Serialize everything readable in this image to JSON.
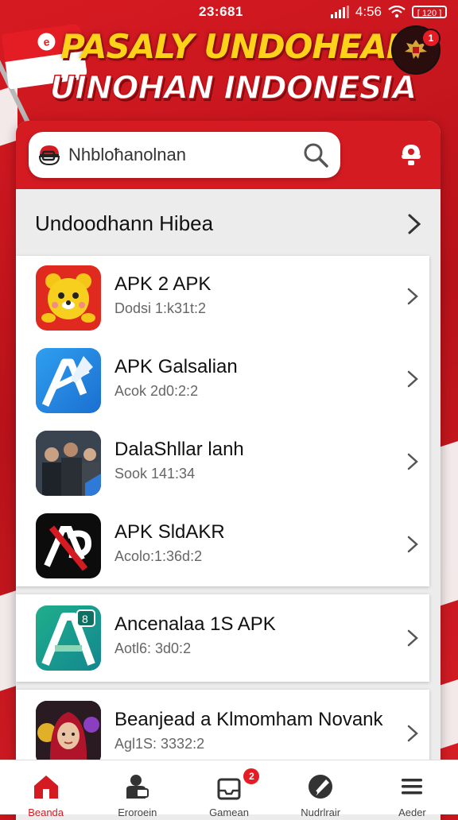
{
  "status_bar": {
    "time": "23:681",
    "carrier": "4:56",
    "battery": "[ 120 ]"
  },
  "header": {
    "title_line1": "PASALY UNDOHEAN",
    "title_line2": "UINOHAN INDONESIA",
    "badge_count": "1"
  },
  "search": {
    "placeholder": "Nhbloħanolnan"
  },
  "section": {
    "title": "Undoodhann Hibea"
  },
  "apps": [
    {
      "name": "APK 2 APK",
      "meta": "Dodsi 1:k31t:2",
      "icon": "bear-icon"
    },
    {
      "name": "APK Galsalian",
      "meta": "Acok 2d0:2:2",
      "icon": "pen-a-icon"
    },
    {
      "name": "DalaShllar lanh",
      "meta": "Sook 141:34",
      "icon": "photo-people-icon"
    },
    {
      "name": "APK SldAKR",
      "meta": "Acolo:1:36d:2",
      "icon": "ap-logo-icon"
    }
  ],
  "featured": [
    {
      "name": "Ancenalaa 1S APK",
      "meta": "Aotl6: 3d0:2",
      "icon": "green-a-icon"
    },
    {
      "name": "Beanjead a Klmomham Novank",
      "meta": "Agl1S: 3332:2",
      "icon": "hijab-avatar-icon"
    }
  ],
  "bottom_nav": [
    {
      "label": "Beanda",
      "icon": "home-icon",
      "active": true
    },
    {
      "label": "Eroroein",
      "icon": "person-card-icon"
    },
    {
      "label": "Gamean",
      "icon": "inbox-icon",
      "badge": "2"
    },
    {
      "label": "Nudrlrair",
      "icon": "brush-icon"
    },
    {
      "label": "Aeder",
      "icon": "menu-icon"
    }
  ],
  "colors": {
    "brand_red": "#d51b22",
    "title_yellow": "#ffd21a"
  }
}
